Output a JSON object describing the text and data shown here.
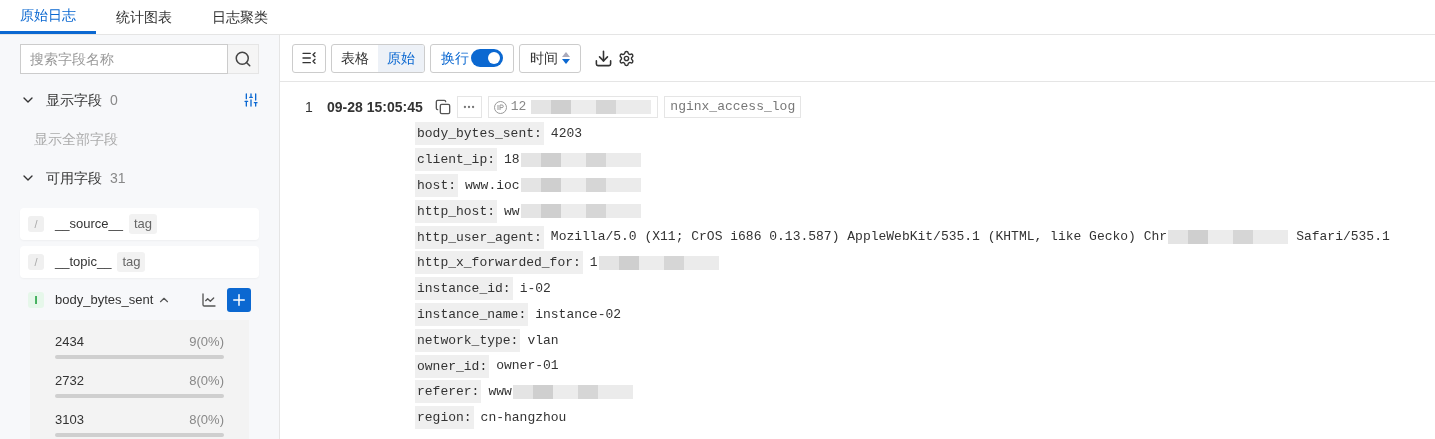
{
  "tabs": [
    {
      "label": "原始日志",
      "selected": true
    },
    {
      "label": "统计图表",
      "selected": false
    },
    {
      "label": "日志聚类",
      "selected": false
    }
  ],
  "sidebar": {
    "search": {
      "placeholder": "搜索字段名称"
    },
    "shown_fields": {
      "title": "显示字段",
      "count": "0",
      "expanded": true,
      "empty_text": "显示全部字段"
    },
    "available_fields": {
      "title": "可用字段",
      "count": "31",
      "expanded": true,
      "items": [
        {
          "kind": "tag",
          "type_mark": "/",
          "name": "__source__",
          "tag": "tag",
          "expanded": false
        },
        {
          "kind": "tag",
          "type_mark": "/",
          "name": "__topic__",
          "tag": "tag",
          "expanded": false
        },
        {
          "kind": "number",
          "type_mark": "l",
          "name": "body_bytes_sent",
          "expanded": true,
          "values": [
            {
              "value": "2434",
              "count": "9(0%)"
            },
            {
              "value": "2732",
              "count": "8(0%)"
            },
            {
              "value": "3103",
              "count": "8(0%)"
            }
          ]
        }
      ]
    }
  },
  "toolbar": {
    "view_modes": [
      {
        "label": "表格",
        "selected": false
      },
      {
        "label": "原始",
        "selected": true
      }
    ],
    "wrap": {
      "label": "换行",
      "on": true
    },
    "sort": {
      "label": "时间"
    }
  },
  "logs": [
    {
      "index": "1",
      "time": "09-28 15:05:45",
      "ip": "12",
      "source": "nginx_access_log",
      "fields": [
        {
          "key": "body_bytes_sent:",
          "value": "4203",
          "redacted": false
        },
        {
          "key": "client_ip:",
          "value": "18",
          "redacted": true
        },
        {
          "key": "host:",
          "value": "www.ioc",
          "redacted": true
        },
        {
          "key": "http_host:",
          "value": "ww",
          "redacted": true
        },
        {
          "key": "http_user_agent:",
          "value": "Mozilla/5.0 (X11; CrOS i686 0.13.587) AppleWebKit/535.1 (KHTML, like Gecko) Chr",
          "redacted": true,
          "tail": "Safari/535.1"
        },
        {
          "key": "http_x_forwarded_for:",
          "value": "1",
          "redacted": true
        },
        {
          "key": "instance_id:",
          "value": "i-02",
          "redacted": false
        },
        {
          "key": "instance_name:",
          "value": "instance-02",
          "redacted": false
        },
        {
          "key": "network_type:",
          "value": "vlan",
          "redacted": false
        },
        {
          "key": "owner_id:",
          "value": "owner-01",
          "redacted": false
        },
        {
          "key": "referer:",
          "value": "www",
          "redacted": true
        },
        {
          "key": "region:",
          "value": "cn-hangzhou",
          "redacted": false
        }
      ]
    }
  ]
}
